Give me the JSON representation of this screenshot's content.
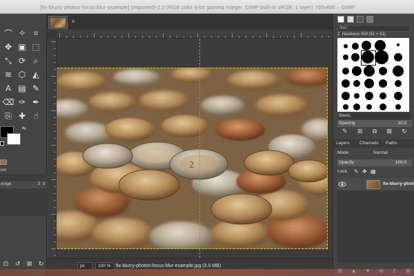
{
  "window": {
    "title": "[fix-blurry-photos-focus-blur-example] (imported)-2.0 (RGB color 8-bit gamma integer, GIMP built-in sRGB, 1 layer) 700x466 – GIMP"
  },
  "toolbox": {
    "tools": [
      "lasso-select-icon",
      "fuzzy-select-icon",
      "crop-icon",
      "move-icon",
      "align-icon",
      "transform-icon",
      "scale-icon",
      "rotate-icon",
      "zoom-icon",
      "warp-icon",
      "cage-icon",
      "bucket-fill-icon",
      "text-icon",
      "gradient-icon",
      "paintbrush-icon",
      "eraser-icon",
      "airbrush-icon",
      "ink-icon",
      "clone-icon",
      "heal-icon",
      "smudge-icon"
    ],
    "tool_options": {
      "section_label": "ion",
      "row_label": "erage",
      "row_value": "3"
    },
    "footer_icons": [
      "save-icon",
      "restore-icon",
      "delete-icon",
      "reset-icon"
    ]
  },
  "image_window": {
    "tab_close": "×",
    "status": {
      "unit": "px",
      "zoom": "100 %",
      "message": "fix-blurry-photos-focus-blur-example.jpg (3.0 MB)"
    }
  },
  "dock": {
    "filter_placeholder": "filter",
    "brush_name": "2. Hardness 050 (51 × 51)",
    "preset": "Basic,",
    "spacing_label": "Spacing",
    "spacing_value": "10.0",
    "layers_tabs": [
      "Layers",
      "Channels",
      "Paths"
    ],
    "mode_label": "Mode",
    "mode_value": "Normal",
    "opacity_label": "Opacity",
    "opacity_value": "100.0",
    "lock_label": "Lock:",
    "layer_name": "fix-blurry-photos"
  }
}
